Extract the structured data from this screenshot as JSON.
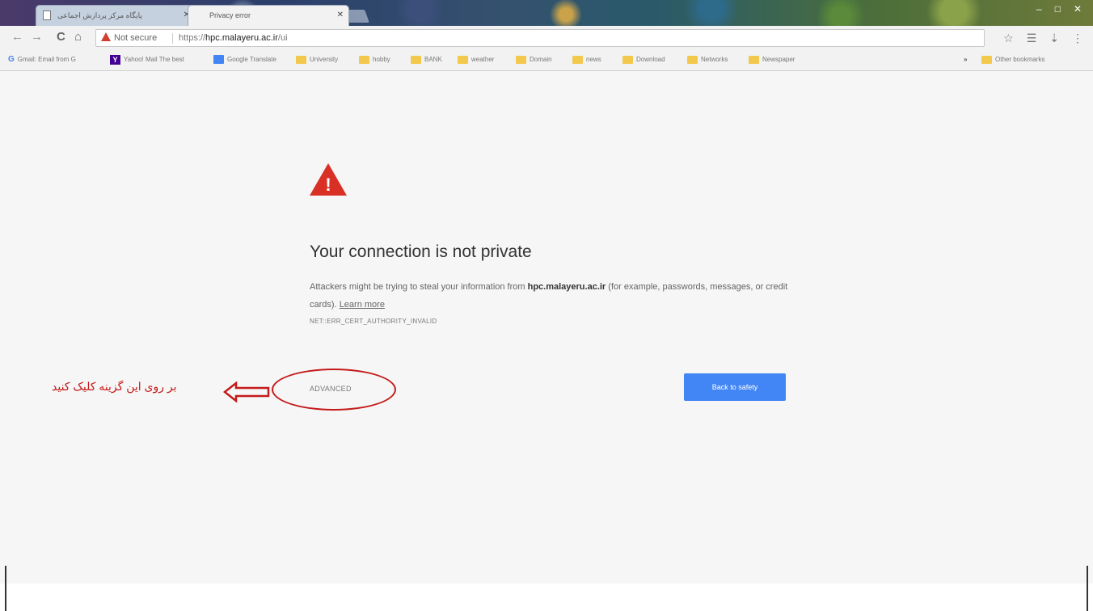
{
  "tabs": [
    {
      "title": "پایگاه مرکز پردازش اجماعی",
      "active": false
    },
    {
      "title": "Privacy error",
      "active": true
    }
  ],
  "window_controls": {
    "minimize": "–",
    "maximize": "□",
    "close": "✕"
  },
  "toolbar": {
    "back": "←",
    "forward": "→",
    "reload": "C",
    "home": "⌂",
    "security_label": "Not secure",
    "url_scheme": "https://",
    "url_host": "hpc.malayeru.ac.ir",
    "url_path": "/ui",
    "star": "☆",
    "menu": "⋮"
  },
  "bookmarks": [
    {
      "label": "Gmail: Email from G",
      "icon": "google-icon"
    },
    {
      "label": "Yahoo! Mail The best",
      "icon": "yahoo-icon"
    },
    {
      "label": "Google Translate",
      "icon": "google-translate-icon"
    },
    {
      "label": "University",
      "icon": "folder-icon"
    },
    {
      "label": "hobby",
      "icon": "folder-icon"
    },
    {
      "label": "BANK",
      "icon": "folder-icon"
    },
    {
      "label": "weather",
      "icon": "folder-icon"
    },
    {
      "label": "Domain",
      "icon": "folder-icon"
    },
    {
      "label": "news",
      "icon": "folder-icon"
    },
    {
      "label": "Download",
      "icon": "folder-icon"
    },
    {
      "label": "Networks",
      "icon": "folder-icon"
    },
    {
      "label": "Newspaper",
      "icon": "folder-icon"
    }
  ],
  "bookmarks_overflow": "»",
  "other_bookmarks": "Other bookmarks",
  "page": {
    "heading": "Your connection is not private",
    "desc_before": "Attackers might be trying to steal your information from ",
    "desc_host": "hpc.malayeru.ac.ir",
    "desc_after": " (for example, passwords, messages, or credit cards). ",
    "learn_more": "Learn more",
    "error_code": "NET::ERR_CERT_AUTHORITY_INVALID",
    "advanced": "ADVANCED",
    "back_to_safety": "Back to safety",
    "warning_glyph": "!"
  },
  "annotation": {
    "text": "بر روی این گزینه کلیک کنید",
    "color": "#c41a1a"
  },
  "colors": {
    "accent_button": "#4285f4",
    "warning_red": "#d93025"
  }
}
